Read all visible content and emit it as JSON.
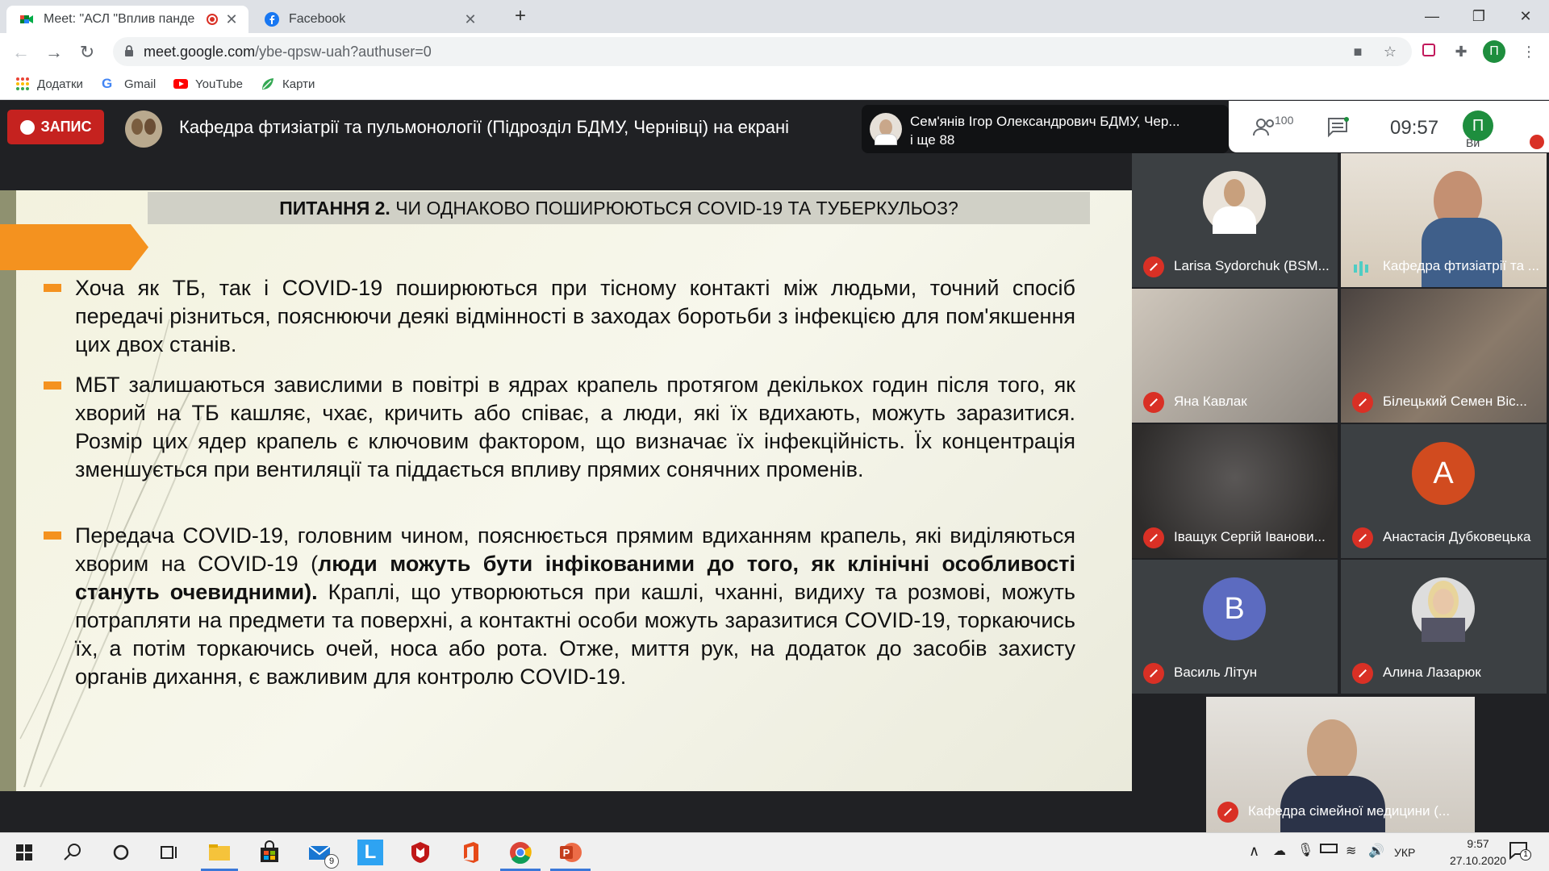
{
  "browser": {
    "tabs": [
      {
        "title": "Meet: \"АСЛ \"Вплив панде",
        "active": true
      },
      {
        "title": "Facebook",
        "active": false
      }
    ],
    "url_host": "meet.google.com",
    "url_path": "/ybe-qpsw-uah?authuser=0",
    "profile_initial": "П",
    "bookmarks": [
      "Додатки",
      "Gmail",
      "YouTube",
      "Карти"
    ]
  },
  "meet": {
    "record_label": "ЗАПИС",
    "presenter_title": "Кафедра фтизіатрії та пульмонології (Підрозділ БДМУ, Чернівці) на екрані",
    "speaker_name": "Сем'янів Ігор Олександрович БДМУ, Чер...",
    "speaker_more": "і ще 88",
    "participant_count": "100",
    "time": "09:57",
    "me_initial": "П",
    "me_label": "Ви"
  },
  "slide": {
    "question_bold": "ПИТАННЯ 2.",
    "question_rest": " ЧИ ОДНАКОВО ПОШИРЮЮТЬСЯ COVID-19 ТА ТУБЕРКУЛЬОЗ?",
    "p1": "Хоча як ТБ, так і COVID-19 поширюються при тісному контакті між людьми, точний спосіб передачі різниться, пояснюючи деякі відмінності в заходах боротьби з інфекцією для пом'якшення цих двох станів.",
    "p2": "МБТ залишаються завислими в повітрі в ядрах крапель протягом декількох годин після того, як хворий на ТБ кашляє, чхає, кричить або співає, а люди, які їх вдихають, можуть заразитися. Розмір цих ядер крапель є ключовим фактором, що визначає їх інфекційність. Їх концентрація зменшується при вентиляції та піддається впливу прямих сонячних променів.",
    "p3_a": "Передача COVID-19, головним чином, пояснюється прямим вдиханням крапель, які виділяються хворим на COVID-19 (",
    "p3_bold": "люди можуть бути інфікованими до того, як клінічні особливості стануть очевидними).",
    "p3_b": " Краплі, що утворюються при кашлі, чханні, видиху та розмові, можуть потрапляти на предмети та поверхні, а контактні особи можуть заразитися COVID-19, торкаючись їх, а потім торкаючись очей, носа або рота. Отже, миття рук, на додаток до засобів захисту органів дихання, є важливим для контролю COVID-19."
  },
  "participants": [
    {
      "name": "Larisa Sydorchuk (BSM...",
      "muted": true
    },
    {
      "name": "Кафедра фтизіатрії та ...",
      "muted": false
    },
    {
      "name": "Яна Кавлак",
      "muted": true
    },
    {
      "name": "Білецький Семен Віс...",
      "muted": true
    },
    {
      "name": "Іващук Сергій Іванови...",
      "muted": true
    },
    {
      "name": "Анастасія Дубковецька",
      "muted": true,
      "initial": "А",
      "color": "#d14b1f"
    },
    {
      "name": "Василь Літун",
      "muted": true,
      "initial": "В",
      "color": "#5c6bc0"
    },
    {
      "name": "Алина Лазарюк",
      "muted": true
    },
    {
      "name": "Кафедра сімейної медицини (...",
      "muted": true
    }
  ],
  "taskbar": {
    "mail_badge": "9",
    "lang": "УКР",
    "time": "9:57",
    "date": "27.10.2020",
    "notif_count": "1"
  },
  "colors": {
    "record_red": "#c5221f",
    "accent_orange": "#f4921f",
    "meet_dark": "#202124"
  }
}
